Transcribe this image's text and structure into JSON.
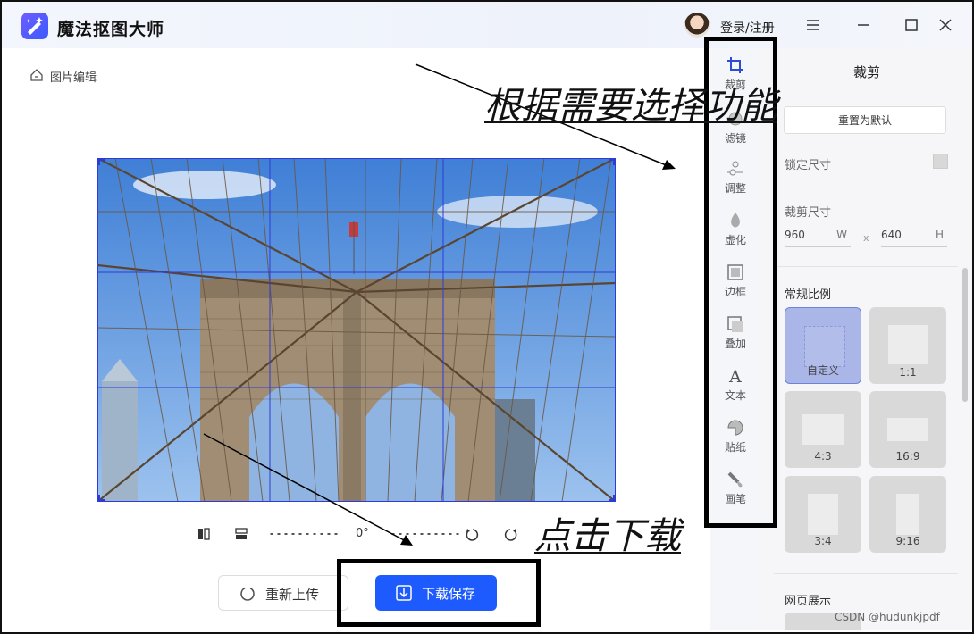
{
  "app": {
    "title": "魔法抠图大师",
    "login": "登录/注册"
  },
  "breadcrumb": {
    "label": "图片编辑"
  },
  "editor": {
    "rotation": "0°"
  },
  "actions": {
    "reupload": "重新上传",
    "download": "下载保存"
  },
  "sidebar": {
    "items": [
      {
        "label": "裁剪",
        "icon": "crop-icon"
      },
      {
        "label": "滤镜",
        "icon": "filter-icon"
      },
      {
        "label": "调整",
        "icon": "adjust-icon"
      },
      {
        "label": "虚化",
        "icon": "blur-icon"
      },
      {
        "label": "边框",
        "icon": "border-icon"
      },
      {
        "label": "叠加",
        "icon": "overlay-icon"
      },
      {
        "label": "文本",
        "icon": "text-icon"
      },
      {
        "label": "贴纸",
        "icon": "sticker-icon"
      },
      {
        "label": "画笔",
        "icon": "brush-icon"
      }
    ]
  },
  "panel": {
    "title": "裁剪",
    "reset": "重置为默认",
    "lock_size": "锁定尺寸",
    "crop_size": "裁剪尺寸",
    "width": "960",
    "width_unit": "W",
    "times": "x",
    "height": "640",
    "height_unit": "H",
    "ratio_section": "常规比例",
    "ratios": [
      "自定义",
      "1:1",
      "4:3",
      "16:9",
      "3:4",
      "9:16"
    ],
    "web_section": "网页展示"
  },
  "annotations": {
    "select_feature": "根据需要选择功能",
    "click_download": "点击下载"
  },
  "watermark": "CSDN @hudunkjpdf"
}
